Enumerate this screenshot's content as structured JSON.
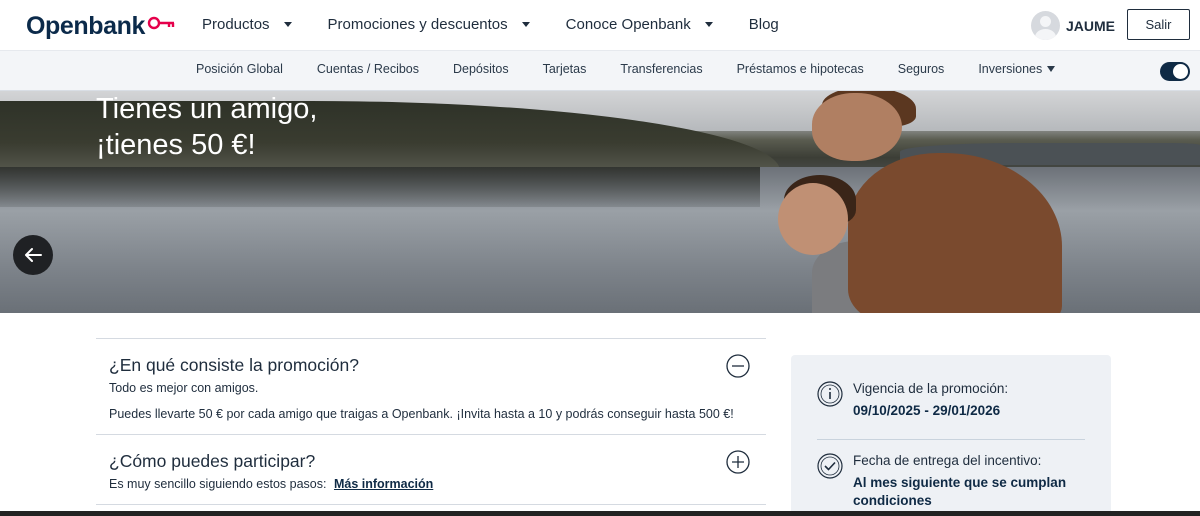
{
  "header": {
    "logo_text": "Openbank",
    "nav": [
      {
        "label": "Productos",
        "has_dropdown": true
      },
      {
        "label": "Promociones y descuentos",
        "has_dropdown": true
      },
      {
        "label": "Conoce Openbank",
        "has_dropdown": true
      },
      {
        "label": "Blog",
        "has_dropdown": false
      }
    ],
    "user_name": "JAUME",
    "logout_label": "Salir"
  },
  "subnav": {
    "items": [
      "Posición Global",
      "Cuentas / Recibos",
      "Depósitos",
      "Tarjetas",
      "Transferencias",
      "Préstamos e hipotecas",
      "Seguros",
      "Inversiones"
    ]
  },
  "hero": {
    "title": "Tienes un amigo,\n¡tienes 50 €!"
  },
  "promo": {
    "section1": {
      "title": "¿En qué consiste la promoción?",
      "text1": "Todo es mejor con amigos.",
      "text2": "Puedes llevarte 50 € por cada amigo que traigas a Openbank. ¡Invita hasta a 10 y podrás conseguir hasta 500 €!"
    },
    "section2": {
      "title": "¿Cómo puedes participar?",
      "text": "Es muy sencillo siguiendo estos pasos:",
      "link": "Más información"
    }
  },
  "infocard": {
    "validity_label": "Vigencia de la promoción:",
    "validity_value": "09/10/2025 - 29/01/2026",
    "delivery_label": "Fecha de entrega del incentivo:",
    "delivery_value": "Al mes siguiente que se cumplan condiciones"
  },
  "colors": {
    "brand_navy": "#0b2a4a",
    "brand_accent": "#e5004b",
    "subnav_bg": "#f3f5f8",
    "card_bg": "#eef1f5"
  }
}
